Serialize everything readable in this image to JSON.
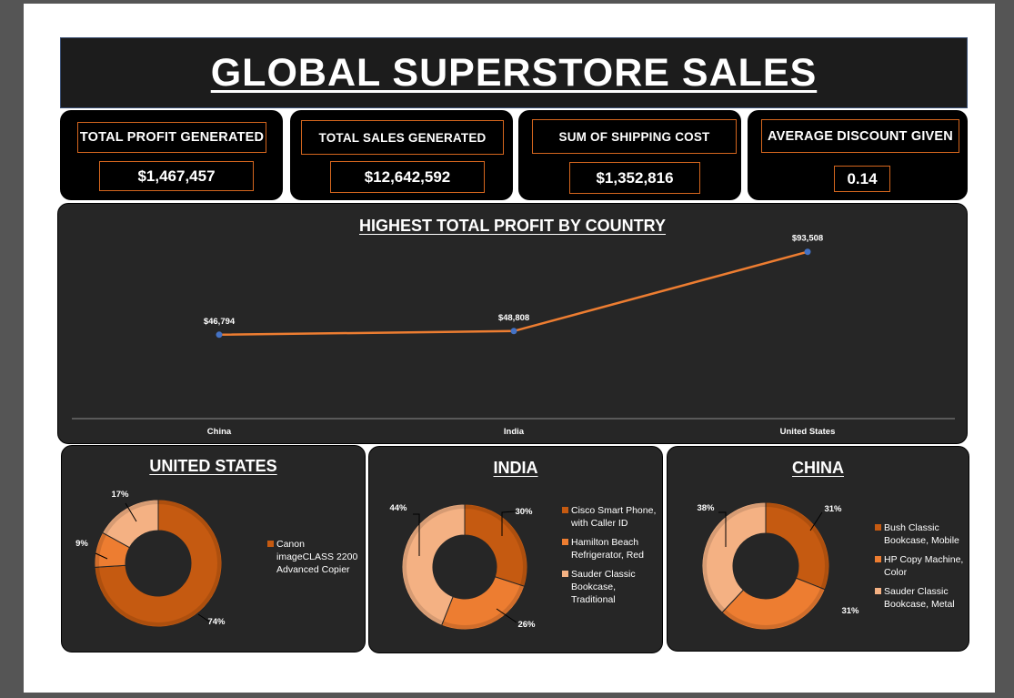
{
  "title": "GLOBAL SUPERSTORE SALES",
  "kpis": [
    {
      "label": "TOTAL PROFIT GENERATED",
      "value": "$1,467,457"
    },
    {
      "label": "TOTAL SALES GENERATED",
      "value": "$12,642,592"
    },
    {
      "label": "SUM OF SHIPPING COST",
      "value": "$1,352,816"
    },
    {
      "label": "AVERAGE DISCOUNT GIVEN",
      "value": "0.14"
    }
  ],
  "colors": {
    "line": "#ed7d31",
    "marker": "#4472c4",
    "slice_dark": "#c55a11",
    "slice_mid": "#ed7d31",
    "slice_light": "#f4b183"
  },
  "line_chart": {
    "title": "HIGHEST TOTAL PROFIT BY COUNTRY",
    "chart_data": {
      "type": "line",
      "categories": [
        "China",
        "India",
        "United States"
      ],
      "values": [
        46794,
        48808,
        93508
      ],
      "data_labels": [
        "$46,794",
        "$48,808",
        "$93,508"
      ],
      "ylim": [
        0,
        100000
      ]
    }
  },
  "donuts": [
    {
      "title": "UNITED STATES",
      "chart_data": {
        "type": "pie",
        "categories": [
          "Canon imageCLASS 2200 Advanced Copier"
        ],
        "values": [
          74,
          9,
          17
        ],
        "data_labels": [
          "74%",
          "9%",
          "17%"
        ]
      },
      "legend": [
        "Canon imageCLASS 2200 Advanced Copier"
      ]
    },
    {
      "title": "INDIA",
      "chart_data": {
        "type": "pie",
        "categories": [
          "Cisco Smart Phone, with Caller ID",
          "Hamilton Beach Refrigerator, Red",
          "Sauder Classic Bookcase, Traditional"
        ],
        "values": [
          30,
          26,
          44
        ],
        "data_labels": [
          "30%",
          "26%",
          "44%"
        ]
      },
      "legend": [
        "Cisco Smart Phone, with Caller ID",
        "Hamilton Beach Refrigerator, Red",
        "Sauder Classic Bookcase, Traditional"
      ]
    },
    {
      "title": "CHINA",
      "chart_data": {
        "type": "pie",
        "categories": [
          "Bush Classic Bookcase, Mobile",
          "HP Copy Machine, Color",
          "Sauder Classic Bookcase, Metal"
        ],
        "values": [
          31,
          31,
          38
        ],
        "data_labels": [
          "31%",
          "31%",
          "38%"
        ]
      },
      "legend": [
        "Bush Classic Bookcase, Mobile",
        "HP Copy Machine, Color",
        "Sauder Classic Bookcase, Metal"
      ]
    }
  ]
}
